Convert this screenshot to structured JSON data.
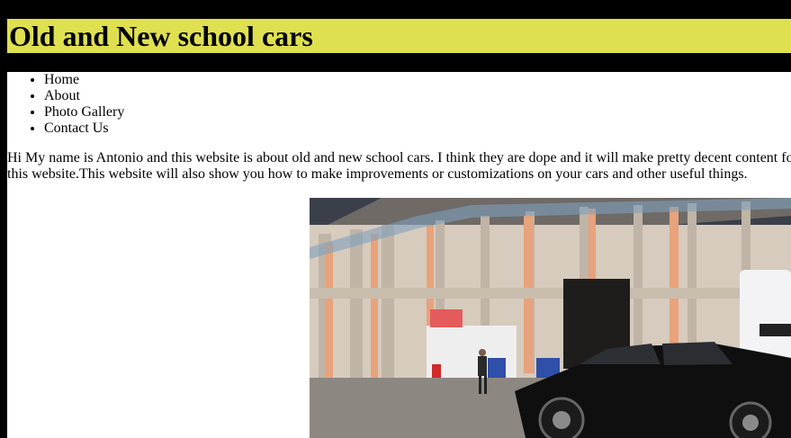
{
  "header": {
    "title": "Old and New school cars"
  },
  "nav": {
    "items": [
      "Home",
      "About",
      "Photo Gallery",
      "Contact Us"
    ]
  },
  "intro": {
    "text": "Hi My name is Antonio and this website is about old and new school cars. I think they are dope and it will make pretty decent content for this website.This website will also show you how to make improvements or customizations on your cars and other useful things."
  },
  "photo": {
    "description_icon": "car-photo"
  },
  "colors": {
    "page_background": "#000000",
    "title_background": "#dfe050",
    "content_background": "#ffffff",
    "text": "#000000"
  }
}
